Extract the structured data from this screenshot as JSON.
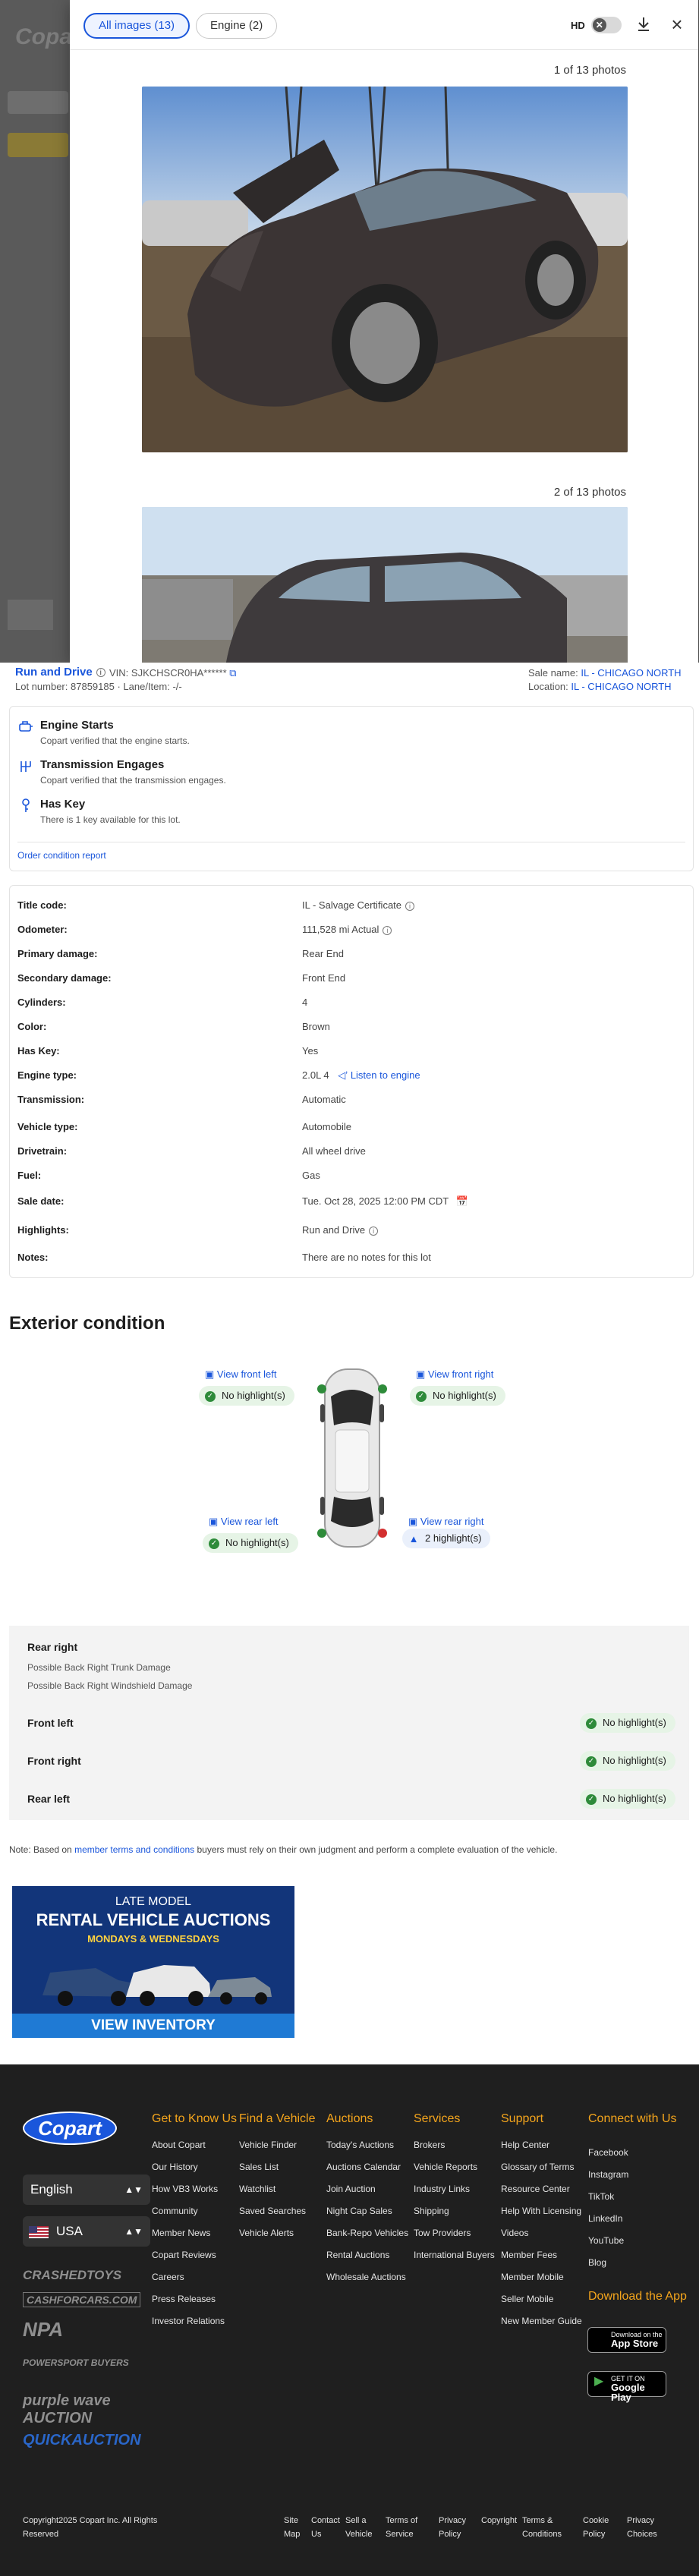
{
  "background": {
    "logo": "Copart"
  },
  "viewer": {
    "tabs": [
      {
        "label": "All images (13)"
      },
      {
        "label": "Engine (2)"
      }
    ],
    "hd_label": "HD",
    "photo_counters": [
      "1 of 13 photos",
      "2 of 13 photos"
    ]
  },
  "lot_bar": {
    "run_drive": "Run and Drive",
    "vin_label": "VIN:",
    "vin": "SJKCHSCR0HA******",
    "lot_label": "Lot number:",
    "lot_number": "87859185",
    "lane_label": "Lane/Item:",
    "lane": "-/-",
    "sale_name_label": "Sale name:",
    "sale_name": "IL - CHICAGO NORTH",
    "location_label": "Location:",
    "location": "IL - CHICAGO NORTH"
  },
  "conditions": {
    "items": [
      {
        "title": "Engine Starts",
        "desc": "Copart verified that the engine starts."
      },
      {
        "title": "Transmission Engages",
        "desc": "Copart verified that the transmission engages."
      },
      {
        "title": "Has Key",
        "desc": "There is 1 key available for this lot."
      }
    ],
    "order_link": "Order condition report"
  },
  "details": [
    {
      "k": "Title code:",
      "v": "IL - Salvage Certificate"
    },
    {
      "k": "Odometer:",
      "v": "111,528 mi Actual"
    },
    {
      "k": "Primary damage:",
      "v": "Rear End"
    },
    {
      "k": "Secondary damage:",
      "v": "Front End"
    },
    {
      "k": "Cylinders:",
      "v": "4"
    },
    {
      "k": "Color:",
      "v": "Brown"
    },
    {
      "k": "Has Key:",
      "v": "Yes"
    },
    {
      "k": "Engine type:",
      "v": "2.0L 4"
    },
    {
      "k": "Transmission:",
      "v": "Automatic"
    },
    {
      "k": "Vehicle type:",
      "v": "Automobile"
    },
    {
      "k": "Drivetrain:",
      "v": "All wheel drive"
    },
    {
      "k": "Fuel:",
      "v": "Gas"
    },
    {
      "k": "Sale date:",
      "v": "Tue. Oct 28, 2025 12:00 PM CDT"
    },
    {
      "k": "Highlights:",
      "v": "Run and Drive"
    },
    {
      "k": "Notes:",
      "v": "There are no notes for this lot"
    }
  ],
  "listen_engine": "Listen to engine",
  "exterior": {
    "title": "Exterior condition",
    "views": [
      {
        "link": "View front left",
        "status": "No highlight(s)"
      },
      {
        "link": "View front right",
        "status": "No highlight(s)"
      },
      {
        "link": "View rear left",
        "status": "No highlight(s)"
      },
      {
        "link": "View rear right",
        "status": "2 highlight(s)"
      }
    ],
    "rear_right": {
      "title": "Rear right",
      "items": [
        "Possible Back Right Trunk Damage",
        "Possible Back Right Windshield Damage"
      ]
    },
    "rows": [
      {
        "label": "Front left",
        "status": "No highlight(s)"
      },
      {
        "label": "Front right",
        "status": "No highlight(s)"
      },
      {
        "label": "Rear left",
        "status": "No highlight(s)"
      }
    ],
    "note_prefix": "Note: Based on",
    "note_link": "member terms and conditions",
    "note_suffix": "buyers must rely on their own judgment and perform a complete evaluation of the vehicle."
  },
  "banner": {
    "line1": "LATE MODEL",
    "line2": "RENTAL VEHICLE AUCTIONS",
    "line3": "MONDAYS & WEDNESDAYS",
    "cta": "VIEW INVENTORY"
  },
  "footer": {
    "logo": "Copart",
    "language": "English",
    "country": "USA",
    "brands": [
      "CRASHEDTOYS",
      "CASHFORCARS.COM",
      "NPA",
      "POWERSPORT BUYERS",
      "purple wave AUCTION",
      "QUICKAUCTION"
    ],
    "columns": [
      {
        "heading": "Get to Know Us",
        "links": [
          "About Copart",
          "Our History",
          "How VB3 Works",
          "Community",
          "Member News",
          "Copart Reviews",
          "Careers",
          "Press Releases",
          "Investor Relations"
        ]
      },
      {
        "heading": "Find a Vehicle",
        "links": [
          "Vehicle Finder",
          "Sales List",
          "Watchlist",
          "Saved Searches",
          "Vehicle Alerts"
        ]
      },
      {
        "heading": "Auctions",
        "links": [
          "Today's Auctions",
          "Auctions Calendar",
          "Join Auction",
          "Night Cap Sales",
          "Bank-Repo Vehicles",
          "Rental Auctions",
          "Wholesale Auctions"
        ]
      },
      {
        "heading": "Services",
        "links": [
          "Brokers",
          "Vehicle Reports",
          "Industry Links",
          "Shipping",
          "Tow Providers",
          "International Buyers"
        ]
      },
      {
        "heading": "Support",
        "links": [
          "Help Center",
          "Glossary of Terms",
          "Resource Center",
          "Help With Licensing",
          "Videos",
          "Member Fees",
          "Member Mobile",
          "Seller Mobile",
          "New Member Guide"
        ]
      },
      {
        "heading": "Connect with Us",
        "links": [
          "Facebook",
          "Instagram",
          "TikTok",
          "LinkedIn",
          "YouTube",
          "Blog"
        ]
      }
    ],
    "download_heading": "Download the App",
    "app_store": {
      "small": "Download on the",
      "big": "App Store"
    },
    "google_play": {
      "small": "GET IT ON",
      "big": "Google Play"
    },
    "copyright": "Copyright2025 Copart Inc. All Rights Reserved",
    "bottom_links": [
      "Site Map",
      "Contact Us",
      "Sell a Vehicle",
      "Terms of Service",
      "Privacy Policy",
      "Copyright",
      "Terms & Conditions",
      "Cookie Policy",
      "Privacy Choices"
    ]
  },
  "colors": {
    "accent": "#1a56db",
    "footer_bg": "#1f1f1f",
    "footer_heading": "#f4a51c",
    "success": "#2e8b3a"
  }
}
